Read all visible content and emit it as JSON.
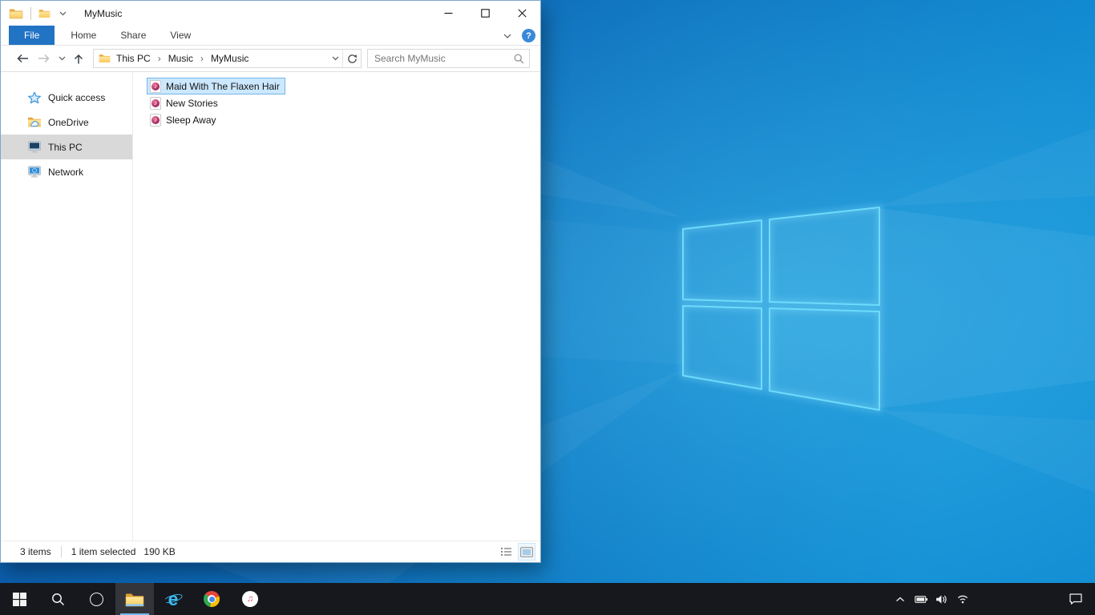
{
  "window": {
    "title": "MyMusic",
    "controls": {
      "minimize": "minimize",
      "maximize": "maximize",
      "close": "close"
    }
  },
  "ribbon": {
    "tabs": [
      {
        "label": "File",
        "active": true
      },
      {
        "label": "Home",
        "active": false
      },
      {
        "label": "Share",
        "active": false
      },
      {
        "label": "View",
        "active": false
      }
    ],
    "help_glyph": "?"
  },
  "navbar": {
    "breadcrumb": [
      {
        "label": "This PC"
      },
      {
        "label": "Music"
      },
      {
        "label": "MyMusic"
      }
    ],
    "separator": "›",
    "search_placeholder": "Search MyMusic"
  },
  "sidebar": {
    "items": [
      {
        "label": "Quick access",
        "icon": "quick-access-star-icon",
        "selected": false
      },
      {
        "label": "OneDrive",
        "icon": "onedrive-folder-icon",
        "selected": false
      },
      {
        "label": "This PC",
        "icon": "this-pc-monitor-icon",
        "selected": true
      },
      {
        "label": "Network",
        "icon": "network-monitor-icon",
        "selected": false
      }
    ]
  },
  "files": [
    {
      "name": "Maid With The Flaxen Hair",
      "icon": "music-file-icon",
      "selected": true
    },
    {
      "name": "New Stories",
      "icon": "music-file-icon",
      "selected": false
    },
    {
      "name": "Sleep Away",
      "icon": "music-file-icon",
      "selected": false
    }
  ],
  "statusbar": {
    "count": "3 items",
    "selection": "1 item selected",
    "size": "190 KB"
  },
  "taskbar": {
    "buttons": [
      "start",
      "search",
      "cortana",
      "file-explorer",
      "internet-explorer",
      "chrome",
      "itunes"
    ],
    "active_button": "file-explorer",
    "tray": [
      "hidden-icons-chevron",
      "battery",
      "volume",
      "wifi",
      "action-center"
    ]
  },
  "icons": {
    "music_note": "♪",
    "itunes_note": "♫",
    "ie_glyph": "e"
  },
  "colors": {
    "file_tab_blue": "#2173c4",
    "selection_fill": "#cce8ff",
    "selection_border": "#77b5e7",
    "sidebar_selected": "#d9d9d9",
    "taskbar_bg": "#16181d",
    "wallpaper_base": "#0c62b2",
    "logo_stroke": "#6ddcfc"
  }
}
